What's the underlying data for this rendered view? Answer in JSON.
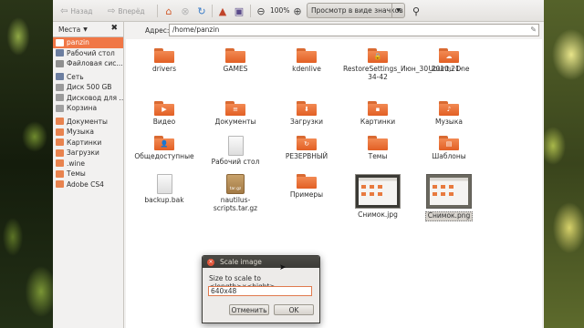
{
  "toolbar": {
    "back_label": "Назад",
    "forward_label": "Вперёд",
    "zoom_value": "100%",
    "view_mode": "Просмотр в виде значков"
  },
  "sidebar": {
    "header": "Места",
    "items": [
      {
        "label": "panzin",
        "color": "#f07746",
        "selected": true
      },
      {
        "label": "Рабочий стол",
        "color": "#6c7ea0"
      },
      {
        "label": "Файловая сис...",
        "color": "#8f8f8f"
      },
      {
        "label": "Сеть",
        "color": "#6c7ea0"
      },
      {
        "label": "Диск 500 GB",
        "color": "#9a9a9a"
      },
      {
        "label": "Дисковод для ...",
        "color": "#9a9a9a"
      },
      {
        "label": "Корзина",
        "color": "#a0a0a0"
      },
      {
        "label": "Документы",
        "color": "#e8834f"
      },
      {
        "label": "Музыка",
        "color": "#e8834f"
      },
      {
        "label": "Картинки",
        "color": "#e8834f"
      },
      {
        "label": "Загрузки",
        "color": "#e8834f"
      },
      {
        "label": ".wine",
        "color": "#e8834f"
      },
      {
        "label": "Темы",
        "color": "#e8834f"
      },
      {
        "label": "Adobe CS4",
        "color": "#e8834f"
      }
    ]
  },
  "address": {
    "label": "Адрес:",
    "path": "/home/panzin"
  },
  "files": [
    {
      "name": "drivers",
      "kind": "folder"
    },
    {
      "name": "GAMES",
      "kind": "folder"
    },
    {
      "name": "kdenlive",
      "kind": "folder"
    },
    {
      "name": "RestoreSettings_Июн_30_2010,21-34-42",
      "kind": "folder",
      "emblem": "🔒"
    },
    {
      "name": "Ubuntu One",
      "kind": "folder",
      "emblem": "☁"
    },
    {
      "name": "Видео",
      "kind": "folder",
      "emblem": "▶"
    },
    {
      "name": "Документы",
      "kind": "folder",
      "emblem": "≡"
    },
    {
      "name": "Загрузки",
      "kind": "folder",
      "emblem": "⬇"
    },
    {
      "name": "Картинки",
      "kind": "folder",
      "emblem": "▪"
    },
    {
      "name": "Музыка",
      "kind": "folder",
      "emblem": "♪"
    },
    {
      "name": "Общедоступные",
      "kind": "folder",
      "emblem": "👤"
    },
    {
      "name": "Рабочий стол",
      "kind": "document"
    },
    {
      "name": "РЕЗЕРВНЫЙ",
      "kind": "folder",
      "emblem": "↻"
    },
    {
      "name": "Темы",
      "kind": "folder"
    },
    {
      "name": "Шаблоны",
      "kind": "folder",
      "emblem": "▤"
    },
    {
      "name": "backup.bak",
      "kind": "document"
    },
    {
      "name": "nautilus-scripts.tar.gz",
      "kind": "archive",
      "emblem": "tar.gz"
    },
    {
      "name": "Примеры",
      "kind": "folder"
    },
    {
      "name": "Снимок.jpg",
      "kind": "image"
    },
    {
      "name": "Снимок.png",
      "kind": "image",
      "selected": true
    }
  ],
  "dialog": {
    "title": "Scale image",
    "prompt": "Size to scale to <length>x<hight>",
    "input_value": "640x48",
    "cancel_label": "Отменить",
    "ok_label": "OK"
  },
  "colors": {
    "accent": "#f07746",
    "folder": "#e8834f",
    "dialog_title_bg": "#3c3b37"
  }
}
